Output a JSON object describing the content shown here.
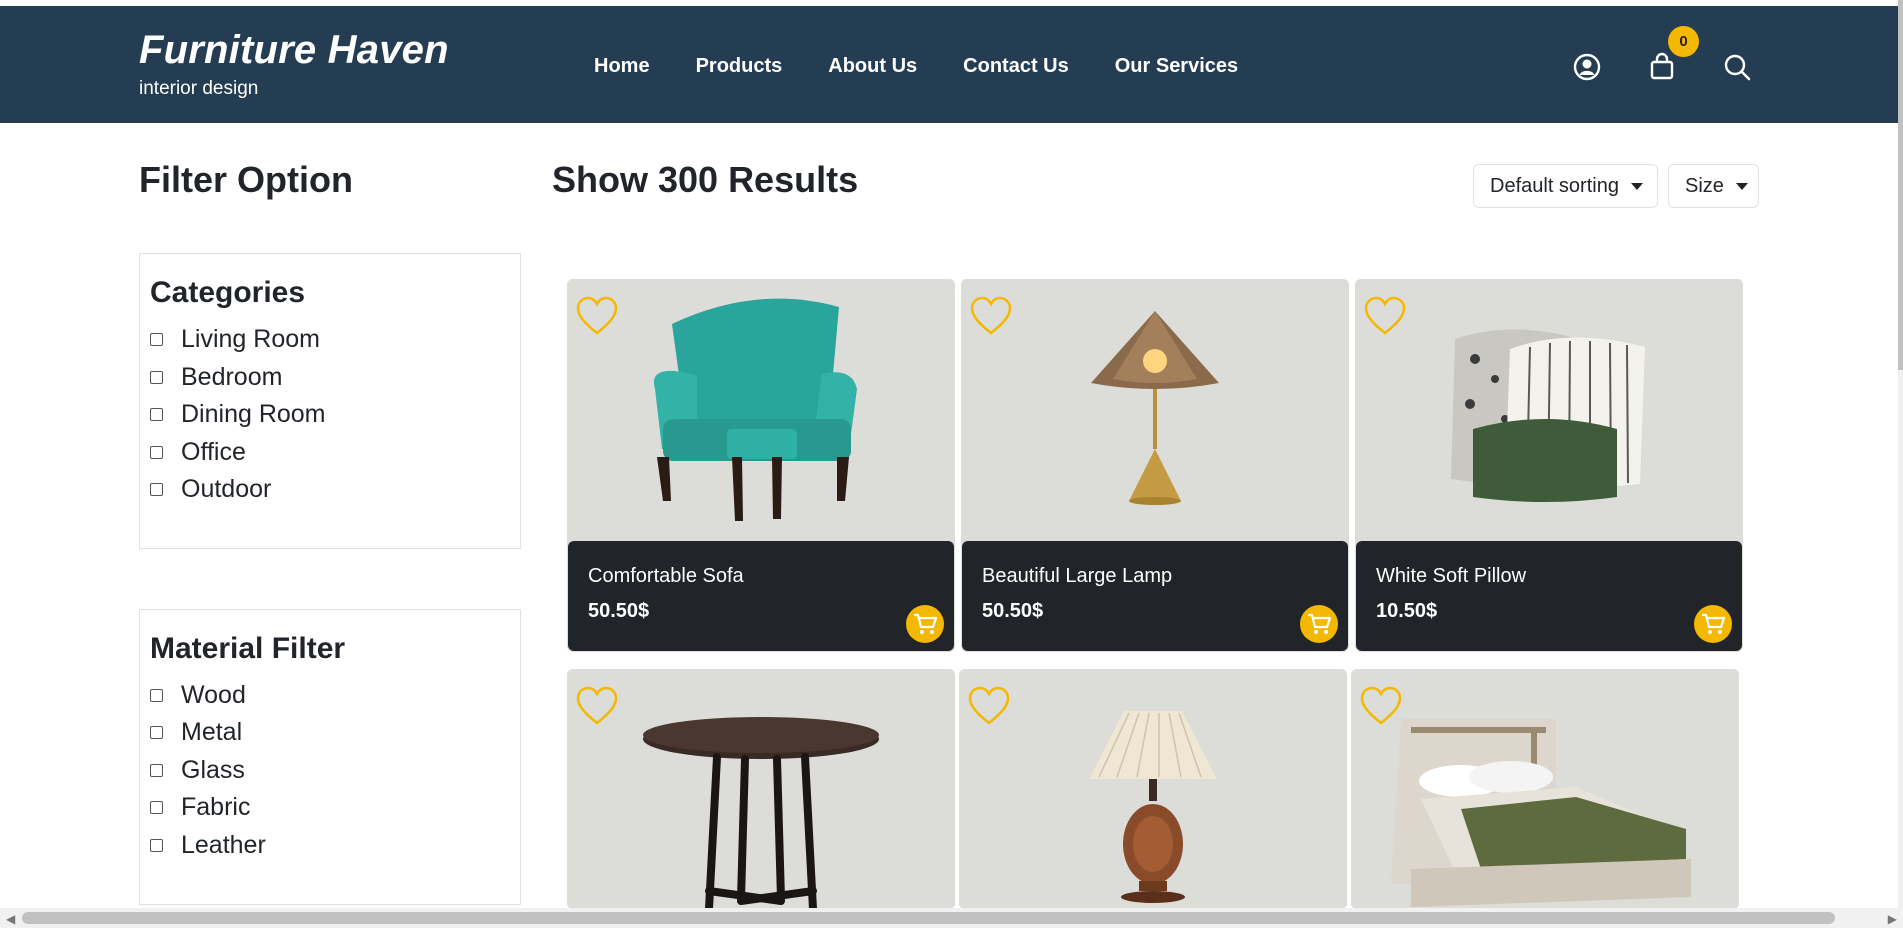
{
  "header": {
    "brand_title": "Furniture Haven",
    "brand_subtitle": "interior design",
    "nav": [
      "Home",
      "Products",
      "About Us",
      "Contact Us",
      "Our Services"
    ],
    "cart_count": "0",
    "icons": [
      "user-circle-icon",
      "shopping-bag-icon",
      "search-icon"
    ]
  },
  "filter": {
    "title": "Filter Option",
    "categories": {
      "title": "Categories",
      "items": [
        "Living Room",
        "Bedroom",
        "Dining Room",
        "Office",
        "Outdoor"
      ]
    },
    "material": {
      "title": "Material Filter",
      "items": [
        "Wood",
        "Metal",
        "Glass",
        "Fabric",
        "Leather"
      ]
    }
  },
  "results": {
    "title": "Show 300 Results",
    "sort_label": "Default sorting",
    "size_label": "Size"
  },
  "products": [
    {
      "name": "Comfortable Sofa",
      "price": "50.50$",
      "image": "teal-armchair"
    },
    {
      "name": "Beautiful Large Lamp",
      "price": "50.50$",
      "image": "brass-cone-lamp"
    },
    {
      "name": "White Soft Pillow",
      "price": "10.50$",
      "image": "pillow-stack"
    },
    {
      "name": "",
      "price": "",
      "image": "round-dining-table"
    },
    {
      "name": "",
      "price": "",
      "image": "pleated-table-lamp"
    },
    {
      "name": "",
      "price": "",
      "image": "upholstered-bed"
    }
  ],
  "colors": {
    "header_bg": "#253d52",
    "accent": "#f5b800",
    "card_info_bg": "#212529",
    "card_image_bg": "#dcdcd8"
  }
}
